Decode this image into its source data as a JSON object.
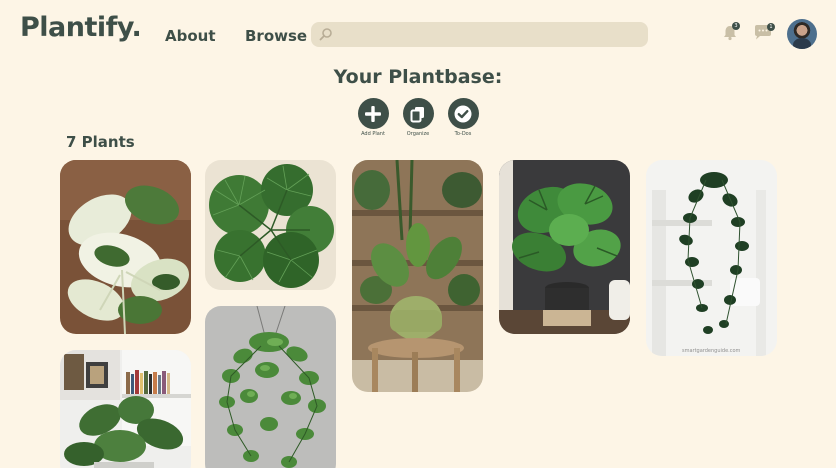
{
  "app": {
    "logo": "Plantify.",
    "nav": {
      "about": "About",
      "browse": "Browse"
    },
    "search": {
      "placeholder": "",
      "value": ""
    },
    "notifications": {
      "bell_count": "3",
      "messages_count": "1"
    }
  },
  "main": {
    "title": "Your Plantbase:",
    "actions": [
      {
        "label": "Add Plant",
        "icon": "plus-icon"
      },
      {
        "label": "Organize",
        "icon": "copy-icon"
      },
      {
        "label": "To-Dos",
        "icon": "check-icon"
      }
    ],
    "plant_count": "7 Plants",
    "plants": [
      {
        "name": "variegated-alocasia"
      },
      {
        "name": "fan-palm"
      },
      {
        "name": "alocasia-pot-stool"
      },
      {
        "name": "monstera"
      },
      {
        "name": "hanging-philodendron"
      },
      {
        "name": "bookshelf-plant"
      },
      {
        "name": "hanging-pothos"
      }
    ],
    "watermark": "smartgardenguide.com"
  },
  "colors": {
    "background": "#fdf5e6",
    "primary": "#3e4f48",
    "search_bg": "#e8dfc9"
  }
}
